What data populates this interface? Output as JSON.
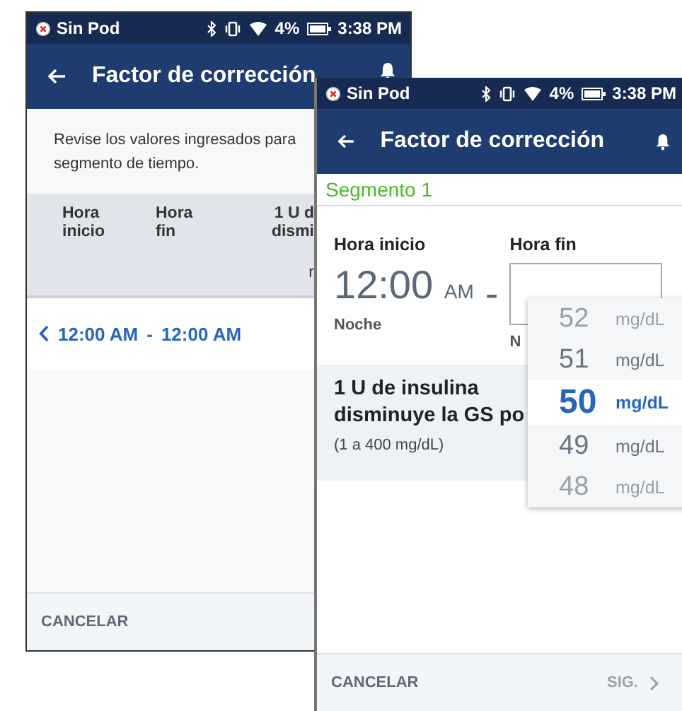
{
  "back_screen": {
    "status_bar": {
      "pod": "Sin Pod",
      "battery": "4%",
      "time": "3:38 PM"
    },
    "title": "Factor de corrección",
    "instructions": [
      "Revise los valores ingresados para",
      "segmento de tiempo."
    ],
    "table": {
      "columns": [
        {
          "lines": [
            "Hora",
            "inicio"
          ]
        },
        {
          "lines": [
            "Hora",
            "fin"
          ]
        },
        {
          "lines": [
            "1 U d",
            "dismi",
            "r"
          ]
        }
      ],
      "rows": [
        {
          "start": "12:00 AM",
          "separator": "-",
          "end": "12:00 AM"
        }
      ]
    },
    "footer": {
      "cancel": "CANCELAR"
    }
  },
  "front_screen": {
    "status_bar": {
      "pod": "Sin Pod",
      "battery": "4%",
      "time": "3:38 PM"
    },
    "title": "Factor de corrección",
    "segment": "Segmento 1",
    "start": {
      "label": "Hora inicio",
      "value": "12:00",
      "ampm": "AM",
      "period": "Noche"
    },
    "dash": "-",
    "end": {
      "label": "Hora fin",
      "period": "N"
    },
    "factor": {
      "label": "1 U de insulina disminuye la GS po",
      "range": "(1 a 400 mg/dL)"
    },
    "picker": [
      {
        "value": "52",
        "unit": "mg/dL",
        "selected": false
      },
      {
        "value": "51",
        "unit": "mg/dL",
        "selected": false
      },
      {
        "value": "50",
        "unit": "mg/dL",
        "selected": true
      },
      {
        "value": "49",
        "unit": "mg/dL",
        "selected": false
      },
      {
        "value": "48",
        "unit": "mg/dL",
        "selected": false
      }
    ],
    "footer": {
      "cancel": "CANCELAR",
      "next": "SIG.",
      "next_disabled": true
    }
  }
}
